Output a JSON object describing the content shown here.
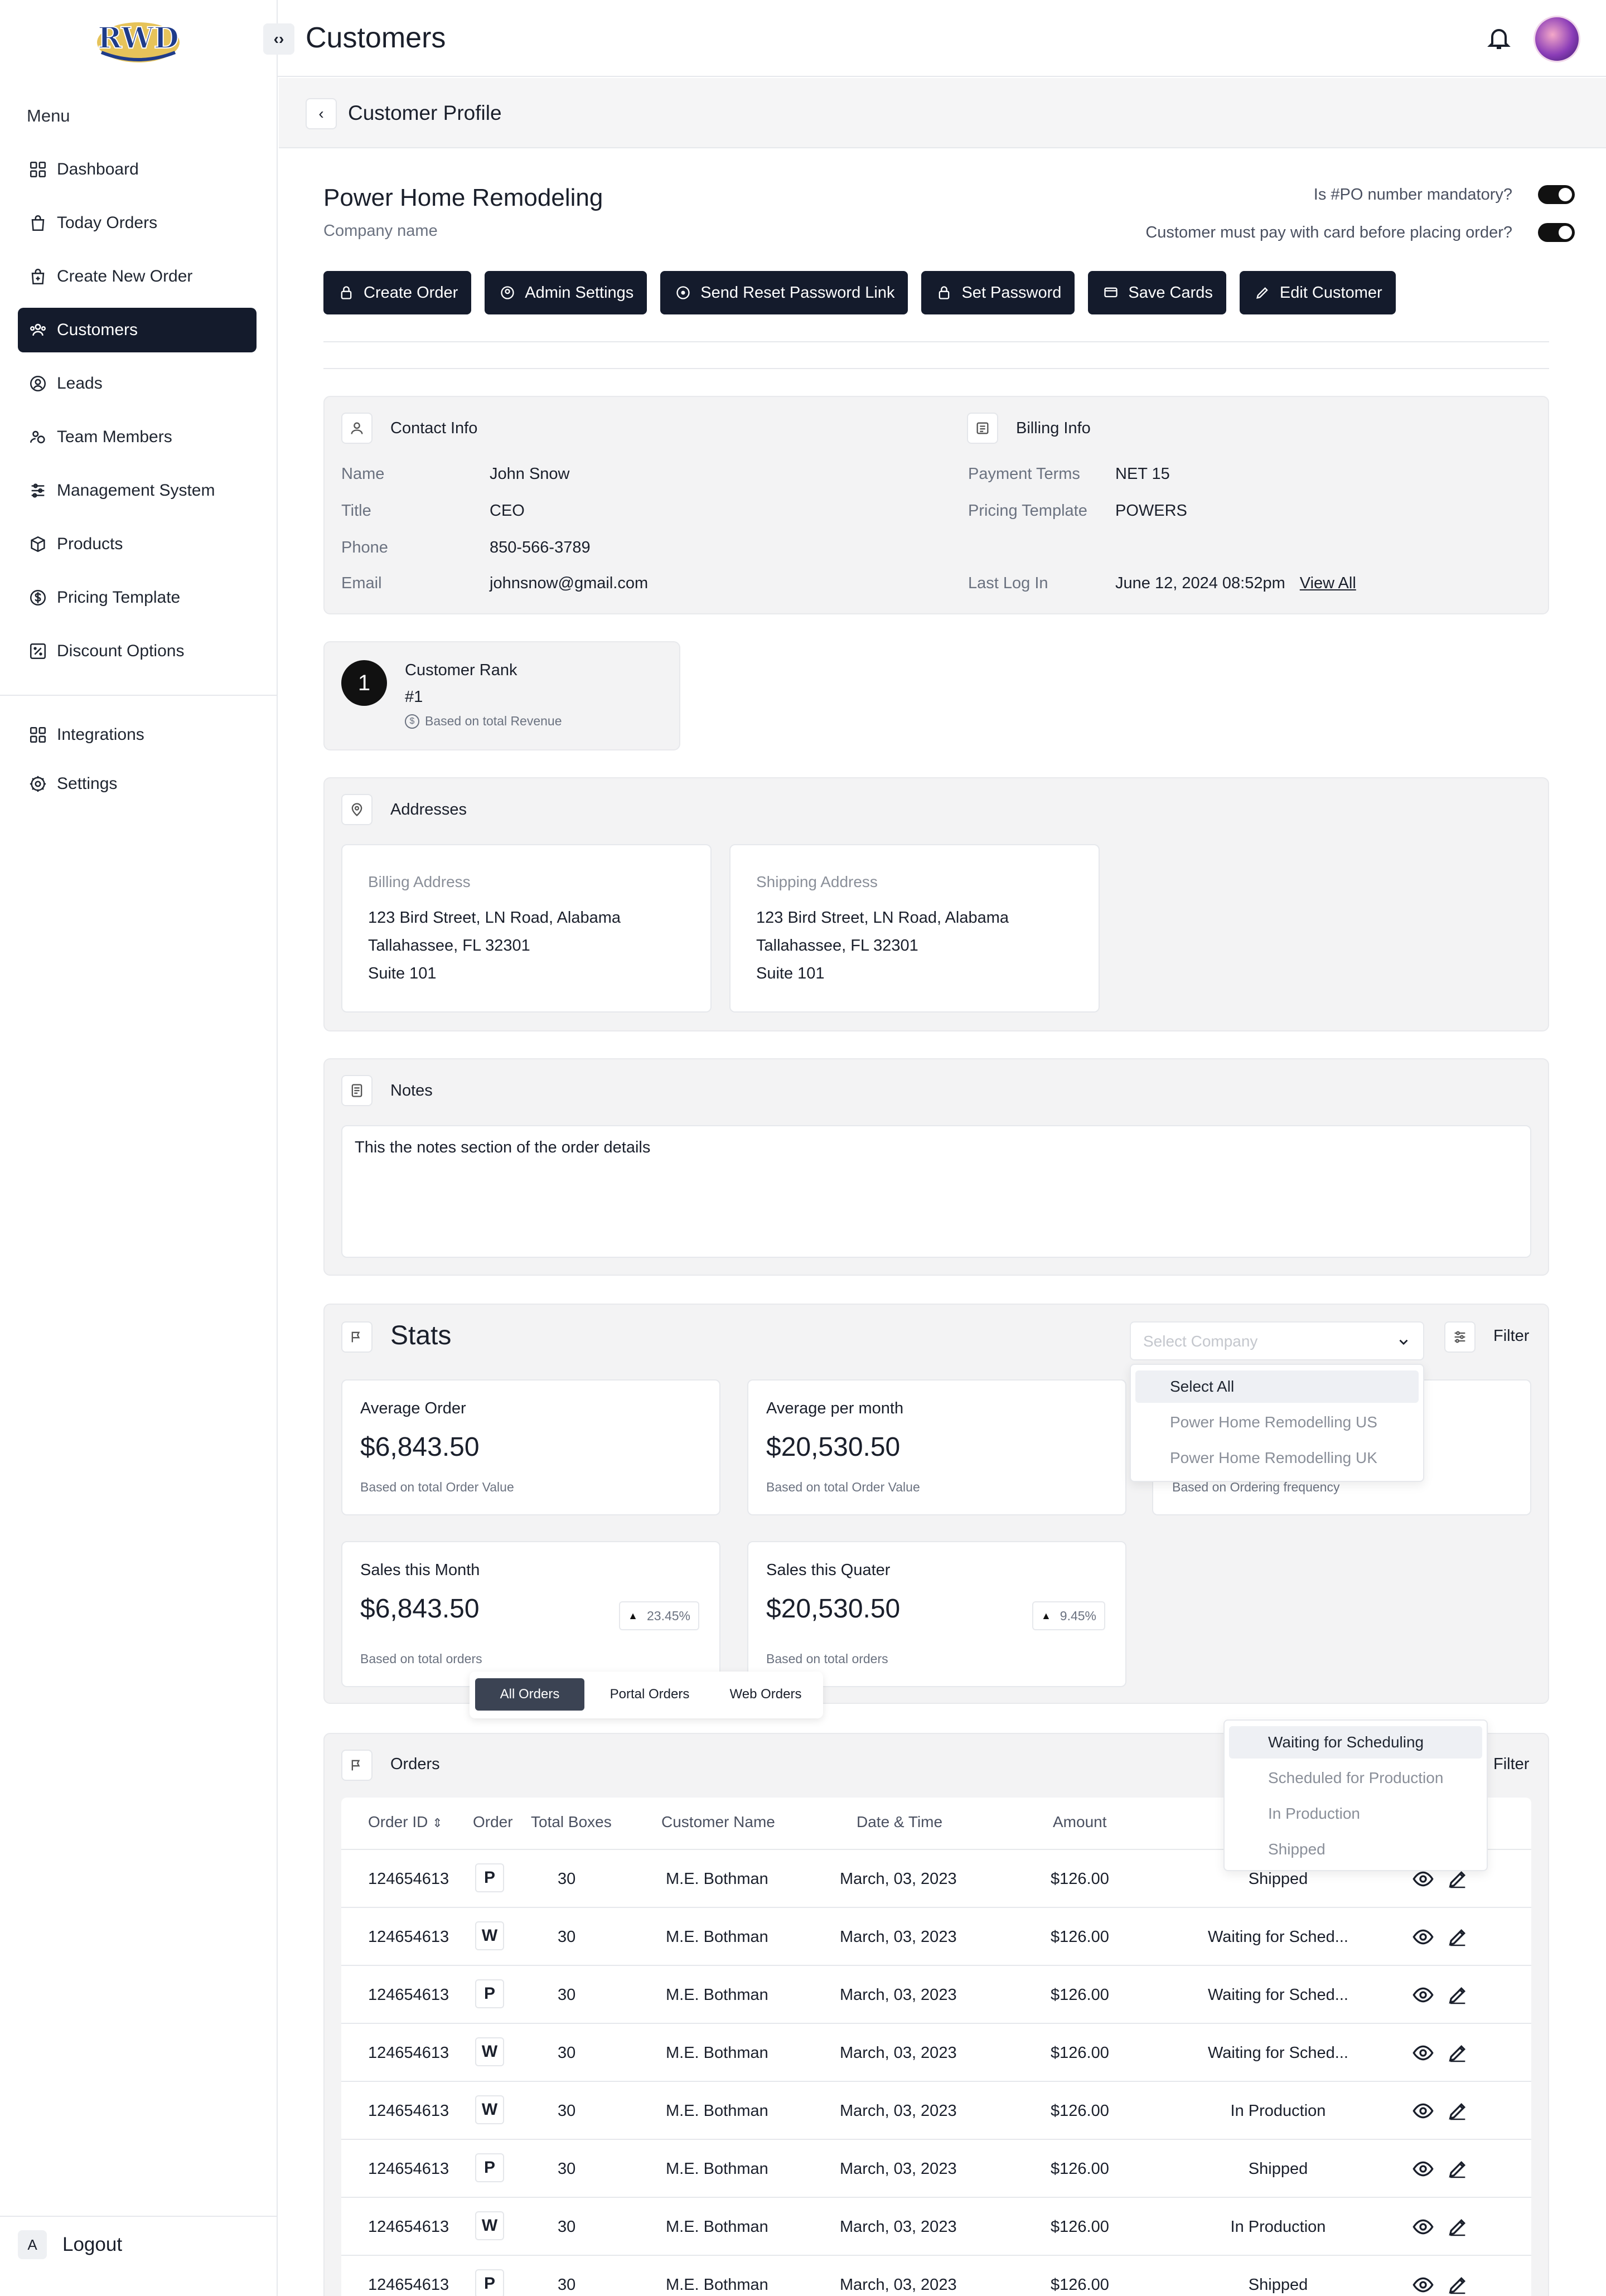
{
  "app": {
    "logo": "RWD",
    "page_title": "Customers",
    "sub_title": "Customer Profile"
  },
  "sidebar": {
    "menu_label": "Menu",
    "items": [
      {
        "label": "Dashboard",
        "icon": "grid-icon"
      },
      {
        "label": "Today Orders",
        "icon": "bag-icon"
      },
      {
        "label": "Create New Order",
        "icon": "bag-plus-icon"
      },
      {
        "label": "Customers",
        "icon": "users-icon"
      },
      {
        "label": "Leads",
        "icon": "lead-icon"
      },
      {
        "label": "Team Members",
        "icon": "team-icon"
      },
      {
        "label": "Management System",
        "icon": "sliders-icon"
      },
      {
        "label": "Products",
        "icon": "box-icon"
      },
      {
        "label": "Pricing Template",
        "icon": "dollar-icon"
      },
      {
        "label": "Discount Options",
        "icon": "percent-icon"
      }
    ],
    "bottom_items": [
      {
        "label": "Integrations",
        "icon": "grid-icon"
      },
      {
        "label": "Settings",
        "icon": "gear-icon"
      }
    ],
    "logout": {
      "initial": "A",
      "label": "Logout"
    }
  },
  "profile": {
    "company": "Power Home Remodeling",
    "company_sub": "Company name",
    "toggle1": "Is #PO number mandatory?",
    "toggle2": "Customer must pay with card before placing order?",
    "buttons": [
      "Create Order",
      "Admin Settings",
      "Send Reset Password Link",
      "Set Password",
      "Save Cards",
      "Edit Customer"
    ]
  },
  "contact": {
    "title": "Contact Info",
    "name_k": "Name",
    "name_v": "John Snow",
    "title_k": "Title",
    "title_v": "CEO",
    "phone_k": "Phone",
    "phone_v": "850-566-3789",
    "email_k": "Email",
    "email_v": "johnsnow@gmail.com"
  },
  "billing": {
    "title": "Billing Info",
    "terms_k": "Payment Terms",
    "terms_v": "NET 15",
    "tpl_k": "Pricing Template",
    "tpl_v": "POWERS",
    "login_k": "Last Log In",
    "login_v": "June 12, 2024 08:52pm",
    "view_all": "View All"
  },
  "rank": {
    "num": "1",
    "title": "Customer Rank",
    "value": "#1",
    "note": "Based on total Revenue"
  },
  "addresses": {
    "title": "Addresses",
    "billing": {
      "label": "Billing Address",
      "l1": "123 Bird Street, LN Road, Alabama",
      "l2": "Tallahassee, FL 32301",
      "l3": "Suite 101"
    },
    "shipping": {
      "label": "Shipping Address",
      "l1": "123 Bird Street, LN Road, Alabama",
      "l2": "Tallahassee, FL 32301",
      "l3": "Suite 101"
    }
  },
  "notes": {
    "title": "Notes",
    "text": "This the notes section of the order details"
  },
  "stats": {
    "title": "Stats",
    "select_placeholder": "Select Company",
    "filter": "Filter",
    "dropdown": [
      "Select All",
      "Power Home Remodelling US",
      "Power Home Remodelling UK"
    ],
    "cards": [
      {
        "label": "Average Order",
        "value": "$6,843.50",
        "note": "Based on total Order Value"
      },
      {
        "label": "Average per month",
        "value": "$20,530.50",
        "note": "Based on total Order Value"
      },
      {
        "note": "Based on Ordering frequency"
      },
      {
        "label": "Sales this Month",
        "value": "$6,843.50",
        "note": "Based on total orders",
        "badge": "23.45%"
      },
      {
        "label": "Sales this Quater",
        "value": "$20,530.50",
        "note": "Based on total orders",
        "badge": "9.45%"
      }
    ],
    "tabs": [
      "All Orders",
      "Portal Orders",
      "Web Orders"
    ]
  },
  "orders": {
    "title": "Orders",
    "filter": "Filter",
    "status_dropdown": [
      "Waiting for Scheduling",
      "Scheduled for Production",
      "In Production",
      "Shipped"
    ],
    "headers": [
      "Order ID",
      "Order",
      "Total Boxes",
      "Customer Name",
      "Date & Time",
      "Amount"
    ],
    "rows": [
      {
        "id": "124654613",
        "type": "P",
        "boxes": "30",
        "name": "M.E. Bothman",
        "date": "March, 03, 2023",
        "amount": "$126.00",
        "status": "Shipped"
      },
      {
        "id": "124654613",
        "type": "W",
        "boxes": "30",
        "name": "M.E. Bothman",
        "date": "March, 03, 2023",
        "amount": "$126.00",
        "status": "Waiting for Sched..."
      },
      {
        "id": "124654613",
        "type": "P",
        "boxes": "30",
        "name": "M.E. Bothman",
        "date": "March, 03, 2023",
        "amount": "$126.00",
        "status": "Waiting for Sched..."
      },
      {
        "id": "124654613",
        "type": "W",
        "boxes": "30",
        "name": "M.E. Bothman",
        "date": "March, 03, 2023",
        "amount": "$126.00",
        "status": "Waiting for Sched..."
      },
      {
        "id": "124654613",
        "type": "W",
        "boxes": "30",
        "name": "M.E. Bothman",
        "date": "March, 03, 2023",
        "amount": "$126.00",
        "status": "In Production"
      },
      {
        "id": "124654613",
        "type": "P",
        "boxes": "30",
        "name": "M.E. Bothman",
        "date": "March, 03, 2023",
        "amount": "$126.00",
        "status": "Shipped"
      },
      {
        "id": "124654613",
        "type": "W",
        "boxes": "30",
        "name": "M.E. Bothman",
        "date": "March, 03, 2023",
        "amount": "$126.00",
        "status": "In Production"
      },
      {
        "id": "124654613",
        "type": "P",
        "boxes": "30",
        "name": "M.E. Bothman",
        "date": "March, 03, 2023",
        "amount": "$126.00",
        "status": "Shipped"
      }
    ]
  }
}
